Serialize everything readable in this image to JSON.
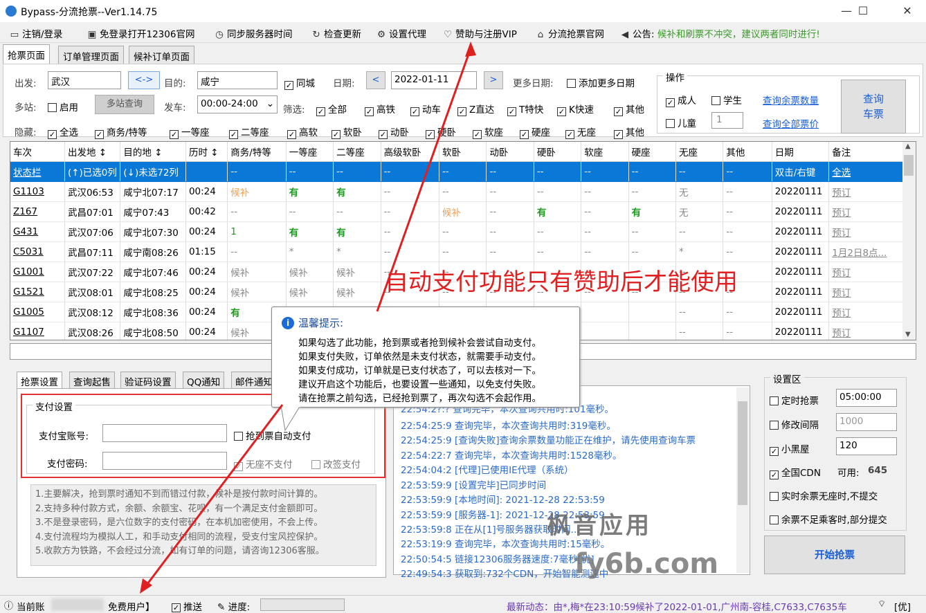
{
  "window": {
    "title": "Bypass-分流抢票--Ver1.14.75",
    "min": "—",
    "max": "☐",
    "close": "✕"
  },
  "toolbar": {
    "items": [
      "注销/登录",
      "免登录打开12306官网",
      "同步服务器时间",
      "检查更新",
      "设置代理",
      "赞助与注册VIP",
      "分流抢票官网",
      "公告:"
    ],
    "notice": "候补和刷票不冲突，建议两者同时进行!"
  },
  "tabs": [
    "抢票页面",
    "订单管理页面",
    "候补订单页面"
  ],
  "query": {
    "from_label": "出发:",
    "from": "武汉",
    "swap": "<->",
    "to_label": "目的:",
    "to": "咸宁",
    "same_city": "同城",
    "date_label": "日期:",
    "date": "2022-01-11",
    "prev": "<",
    "next": ">",
    "more_dates_label": "更多日期:",
    "add_more_dates": "添加更多日期",
    "multi_label": "多站:",
    "enable": "启用",
    "multi_query": "多站查询",
    "depart_label": "发车:",
    "depart_time": "00:00-24:00",
    "filter_label": "筛选:",
    "filters": [
      "全部",
      "高铁",
      "动车",
      "Z直达",
      "T特快",
      "K快速",
      "其他"
    ],
    "hide_label": "隐藏:",
    "hides": [
      "全选",
      "商务/特等",
      "一等座",
      "二等座",
      "高软",
      "软卧",
      "动卧",
      "硬卧",
      "软座",
      "硬座",
      "无座",
      "其他"
    ]
  },
  "ops": {
    "title": "操作",
    "adult": "成人",
    "student": "学生",
    "child": "儿童",
    "child_count": "1",
    "query_remaining": "查询余票数量",
    "query_prices": "查询全部票价",
    "query_btn_1": "查询",
    "query_btn_2": "车票"
  },
  "grid": {
    "headers": [
      "车次",
      "出发地 ↕",
      "目的地 ↕",
      "历时 ↕",
      "商务/特等",
      "一等座",
      "二等座",
      "高级软卧",
      "软卧",
      "动卧",
      "硬卧",
      "软座",
      "硬座",
      "无座",
      "其他",
      "日期",
      "备注"
    ],
    "rows": [
      [
        "状态栏",
        "(↑)已选0列",
        "(↓)未选72列",
        "",
        "--",
        "--",
        "--",
        "--",
        "--",
        "--",
        "--",
        "--",
        "--",
        "--",
        "--",
        "双击/右键",
        "全选"
      ],
      [
        "G1103",
        "武汉06:53",
        "咸宁北07:17",
        "00:24",
        "候补",
        "有",
        "有",
        "--",
        "--",
        "--",
        "--",
        "--",
        "--",
        "无",
        "--",
        "20220111",
        "预订"
      ],
      [
        "Z167",
        "武昌07:01",
        "咸宁07:43",
        "00:42",
        "--",
        "--",
        "--",
        "--",
        "候补",
        "--",
        "有",
        "--",
        "有",
        "无",
        "--",
        "20220111",
        "预订"
      ],
      [
        "G431",
        "武汉07:06",
        "咸宁北07:30",
        "00:24",
        "1",
        "有",
        "有",
        "--",
        "--",
        "--",
        "--",
        "--",
        "--",
        "--",
        "--",
        "20220111",
        "预订"
      ],
      [
        "C5031",
        "武昌07:11",
        "咸宁南08:26",
        "01:15",
        "--",
        "*",
        "*",
        "--",
        "--",
        "--",
        "--",
        "--",
        "--",
        "*",
        "--",
        "20220111",
        "1月2日8点..."
      ],
      [
        "G1001",
        "武汉07:22",
        "咸宁北07:46",
        "00:24",
        "候补",
        "候补",
        "候补",
        "--",
        "--",
        "--",
        "--",
        "--",
        "--",
        "--",
        "--",
        "20220111",
        "预订"
      ],
      [
        "G1521",
        "武汉08:01",
        "咸宁北08:25",
        "00:24",
        "候补",
        "候补",
        "候补",
        "--",
        "--",
        "--",
        "--",
        "--",
        "--",
        "--",
        "--",
        "20220111",
        "预订"
      ],
      [
        "G1005",
        "武汉08:12",
        "咸宁北08:36",
        "00:24",
        "有",
        "",
        "",
        "",
        "",
        "",
        "",
        "",
        "",
        "--",
        "--",
        "20220111",
        "预订"
      ],
      [
        "G1107",
        "武汉08:26",
        "咸宁北08:50",
        "00:24",
        "候补",
        "",
        "",
        "",
        "",
        "",
        "",
        "",
        "",
        "--",
        "--",
        "20220111",
        "预订"
      ]
    ]
  },
  "bottom_tabs": [
    "抢票设置",
    "查询起售",
    "验证码设置",
    "QQ通知",
    "邮件通知"
  ],
  "pay": {
    "group": "支付设置",
    "alipay_label": "支付宝账号:",
    "pwd_label": "支付密码:",
    "auto_pay": "抢到票自动支付",
    "no_seat_skip": "无座不支付",
    "change_pay": "改签支付"
  },
  "notes": [
    "1.主要解决，抢到票时通知不到而错过付款，候补是按付款时间计算的。",
    "2.支持多种付款方式，余额、余额宝、花呗，有一个满足支付金额即可。",
    "3.不是登录密码，是六位数字的支付密码，在本机加密使用，不会上传。",
    "4.支付流程均为模拟人工，和手动支付相同的流程，受支付宝风控保护。",
    "5.收款方为铁路，不会经过分流，如有订单的问题，请咨询12306客服。"
  ],
  "log": [
    "22:54:2?:?  查询完毕，本次查询共用时:101毫秒。",
    "22:54:25:9  查询完毕，本次查询共用时:319毫秒。",
    "22:54:25:9  [查询失败]查询余票数量功能正在维护，请先使用查询车票",
    "22:54:22:7  查询完毕，本次查询共用时:1528毫秒。",
    "22:54:04:2  [代理]已使用IE代理（系统）",
    "22:53:59:9  [设置完毕]已同步时间",
    "22:53:59:9  [本地时间]: 2021-12-28 22:53:59",
    "22:53:59:9  [服务器-1]: 2021-12-28 22:53:59",
    "22:53:59:8  正在从[1]号服务器获取时间...",
    "22:53:19:9  查询完毕，本次查询共用时:15毫秒。",
    "22:50:54:5  链接12306服务器速度:7毫秒[优]",
    "22:49:54:3  获取到:732个CDN，开始智能测速中"
  ],
  "settings": {
    "title": "设置区",
    "timed": "定时抢票",
    "timed_val": "05:00:00",
    "interval": "修改间隔",
    "interval_val": "1000",
    "blackroom": "小黑屋",
    "blackroom_val": "120",
    "cdn": "全国CDN",
    "cdn_avail": "可用:",
    "cdn_count": "645",
    "realtime": "实时余票无座时,不提交",
    "partial": "余票不足乘客时,部分提交",
    "start": "开始抢票"
  },
  "tooltip": {
    "title": "温馨提示:",
    "lines": [
      "如果勾选了此功能，抢到票或者抢到候补会尝试自动支付。",
      "如果支付失败，订单依然是未支付状态，就需要手动支付。",
      "如果支付成功，订单就是已支付状态了，可以去核对一下。",
      "建议开启这个功能后，也要设置一些通知，以免支付失败。",
      "请在抢票之前勾选，已经抢到票了，再次勾选不会起作用。"
    ]
  },
  "annotation": "自动支付功能只有赞助后才能使用",
  "watermark": {
    "line1": "枫音应用",
    "line2": "fy6b.com"
  },
  "statusbar": {
    "account": "当前账",
    "user_type": "免费用户】",
    "push": "推送",
    "progress_label": "进度:",
    "news": "最新动态：由*,梅*在23:10:59候补了2022-01-01,广州南-容桂,C7633,C7635车",
    "quality": "[优]"
  },
  "colors": {
    "accent": "#0a78d7",
    "annotation_red": "#e02020",
    "link": "#1a5fd6",
    "yes_green": "#1a9a1a",
    "notice_green": "#3a9a2a"
  }
}
